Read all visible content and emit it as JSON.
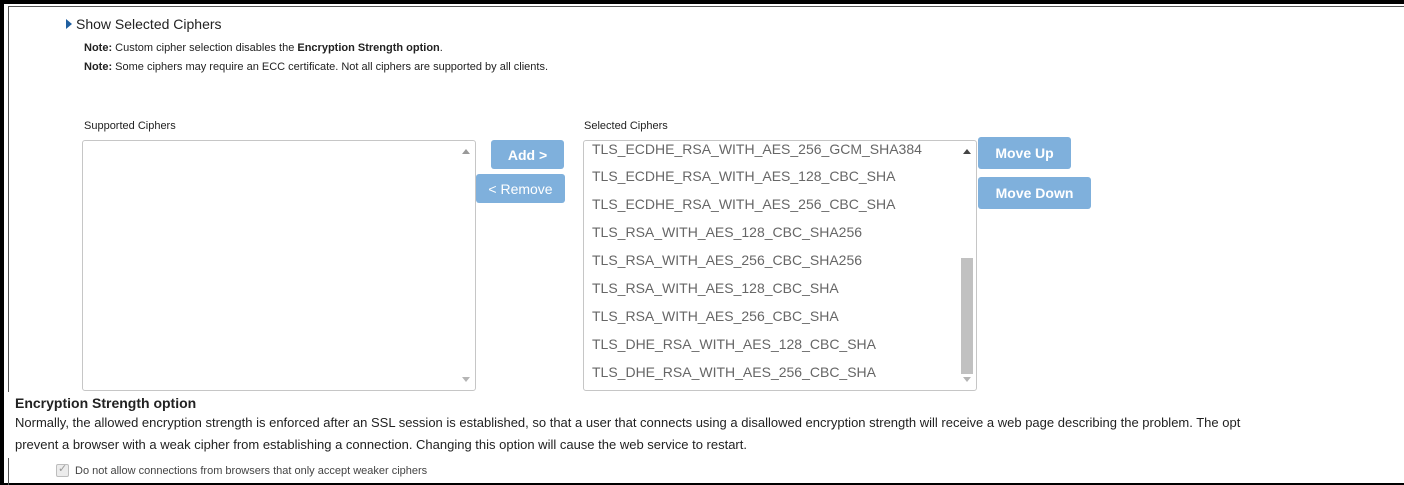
{
  "toggle_label": "Show Selected Ciphers",
  "notes": [
    {
      "bold": "Note:",
      "text_before": " Custom cipher selection disables the ",
      "bold2": "Encryption Strength option",
      "text_after": "."
    },
    {
      "bold": "Note:",
      "text": " Some ciphers may require an ECC certificate. Not all ciphers are supported by all clients."
    }
  ],
  "supported": {
    "label": "Supported Ciphers",
    "items": []
  },
  "selected": {
    "label": "Selected Ciphers",
    "items": [
      "TLS_ECDHE_RSA_WITH_AES_256_GCM_SHA384",
      "TLS_ECDHE_RSA_WITH_AES_128_CBC_SHA",
      "TLS_ECDHE_RSA_WITH_AES_256_CBC_SHA",
      "TLS_RSA_WITH_AES_128_CBC_SHA256",
      "TLS_RSA_WITH_AES_256_CBC_SHA256",
      "TLS_RSA_WITH_AES_128_CBC_SHA",
      "TLS_RSA_WITH_AES_256_CBC_SHA",
      "TLS_DHE_RSA_WITH_AES_128_CBC_SHA",
      "TLS_DHE_RSA_WITH_AES_256_CBC_SHA"
    ]
  },
  "buttons": {
    "add": "Add >",
    "remove": "< Remove",
    "move_up": "Move Up",
    "move_down": "Move Down"
  },
  "strength": {
    "heading": "Encryption Strength option",
    "line1": "Normally, the allowed encryption strength is enforced after an SSL session is established, so that a user that connects using a disallowed encryption strength will receive a web page describing the problem. The opt",
    "line2": "prevent a browser with a weak cipher from establishing a connection. Changing this option will cause the web service to restart.",
    "checkbox_label": "Do not allow connections from browsers that only accept weaker ciphers",
    "checkbox_checked": true
  },
  "colors": {
    "button": "#7fb0dc",
    "toggle_arrow": "#1f5fa0"
  }
}
